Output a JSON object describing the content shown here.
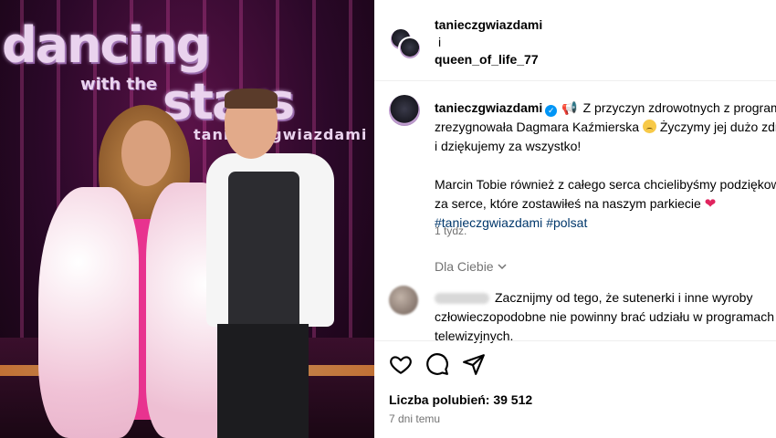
{
  "photo": {
    "logo_line1": "dancing",
    "logo_line2_prefix": "with the",
    "logo_line2": "stars",
    "logo_sub": "taniec z gwiazdami"
  },
  "collab": {
    "author1": "tanieczgwiazdami",
    "conjunction": "i",
    "author2": "queen_of_life_77"
  },
  "caption": {
    "username": "tanieczgwiazdami",
    "line1": "Z przyczyn zdrowotnych z programu",
    "line2": "zrezygnowała Dagmara Kaźmierska",
    "line2b": "Życzymy jej dużo zdrowia",
    "line3": "i dziękujemy za wszystko!",
    "line4": "Marcin Tobie również z całego serca chcielibyśmy podziękować",
    "line5": "za serce, które zostawiłeś na naszym parkiecie",
    "hashtag1": "#tanieczgwiazdami",
    "hashtag2": "#polsat",
    "time": "1 tydz."
  },
  "for_you": {
    "label": "Dla Ciebie"
  },
  "comment": {
    "line1": "Zacznijmy od tego, że sutenerki i inne wyroby",
    "line2": "człowieczopodobne nie powinny brać udziału w programach",
    "line3": "telewizyjnych."
  },
  "footer": {
    "likes_label": "Liczba polubień: 39 512",
    "date": "7 dni temu"
  },
  "colors": {
    "verified": "#0095f6",
    "hashtag": "#00376b",
    "muted": "#737373"
  }
}
